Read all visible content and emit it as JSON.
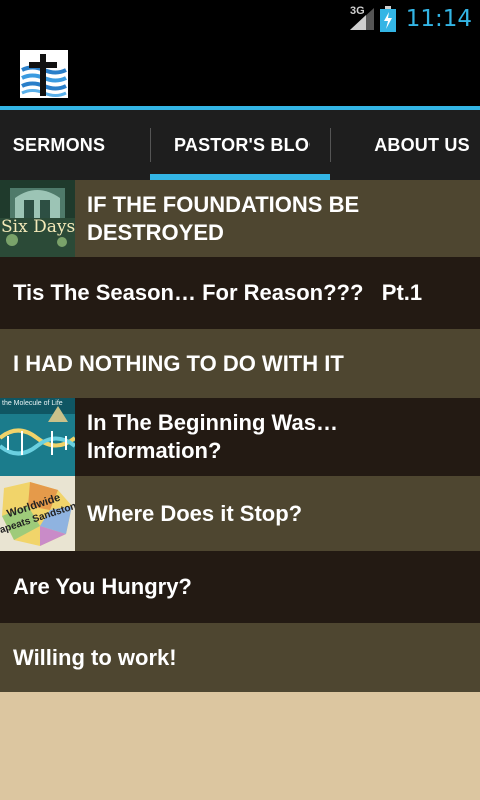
{
  "status_bar": {
    "network_type": "3G",
    "time": "11:14",
    "icons": [
      "signal-icon",
      "battery-charging-icon"
    ]
  },
  "action_bar": {
    "logo_icon": "church-cross-wave-logo"
  },
  "tabs": [
    {
      "label": "SERMONS",
      "selected": false
    },
    {
      "label": "PASTOR'S BLOG",
      "selected": true
    },
    {
      "label": "ABOUT US",
      "selected": false
    }
  ],
  "colors": {
    "accent": "#33b5e5",
    "row_olive": "#4e4630",
    "row_dark": "#231a13",
    "background": "#dcc6a0"
  },
  "posts": [
    {
      "title": "IF THE FOUNDATIONS BE DESTROYED",
      "thumb_text": "Six Days"
    },
    {
      "title": "Tis The Season… For Reason???   Pt.1"
    },
    {
      "title": "I HAD NOTHING TO DO WITH IT"
    },
    {
      "title": "In The Beginning Was… Information?",
      "thumb_text": "the Molecule of Life"
    },
    {
      "title": "Where Does it Stop?",
      "thumb_text_1": "Worldwide",
      "thumb_text_2": "apeats Sandstone"
    },
    {
      "title": "Are You Hungry?"
    },
    {
      "title": "Willing to work!"
    }
  ]
}
